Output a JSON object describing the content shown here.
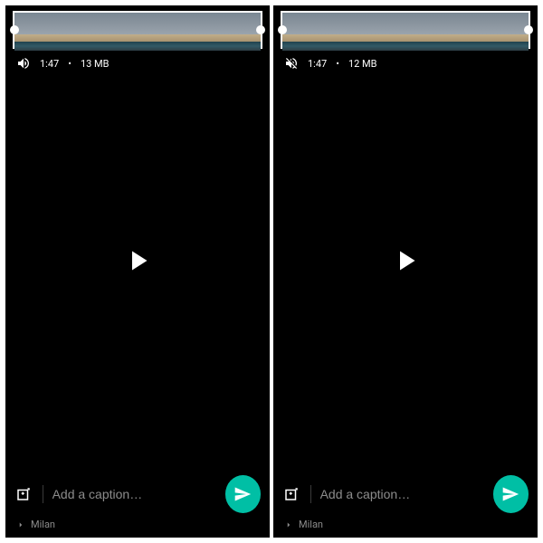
{
  "left": {
    "sound_on": true,
    "duration": "1:47",
    "size": "13 MB",
    "separator": "•",
    "caption_placeholder": "Add a caption…",
    "recipient": "Milan"
  },
  "right": {
    "sound_on": false,
    "duration": "1:47",
    "size": "12 MB",
    "separator": "•",
    "caption_placeholder": "Add a caption…",
    "recipient": "Milan"
  },
  "colors": {
    "accent": "#00BFA5"
  }
}
